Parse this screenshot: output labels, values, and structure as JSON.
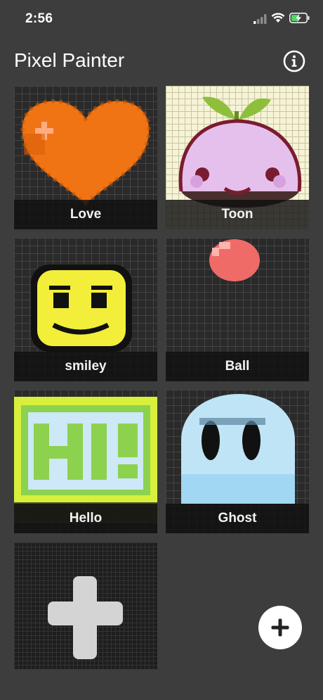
{
  "status_bar": {
    "time": "2:56"
  },
  "header": {
    "title": "Pixel Painter",
    "info_icon": "info-circle-icon"
  },
  "drawings": [
    {
      "name": "Love"
    },
    {
      "name": "Toon"
    },
    {
      "name": "smiley"
    },
    {
      "name": "Ball"
    },
    {
      "name": "Hello"
    },
    {
      "name": "Ghost"
    }
  ],
  "new_drawing_tile": {
    "icon": "plus-icon"
  },
  "fab": {
    "icon": "plus-icon"
  },
  "colors": {
    "background": "#3d3d3d",
    "heart_orange": "#f07414",
    "toon_pink": "#e6c0ec",
    "smiley_yellow": "#f2ee3a",
    "ball_red": "#ef6b68",
    "hello_green": "#8cd24e",
    "ghost_blue": "#bfe4f6"
  }
}
